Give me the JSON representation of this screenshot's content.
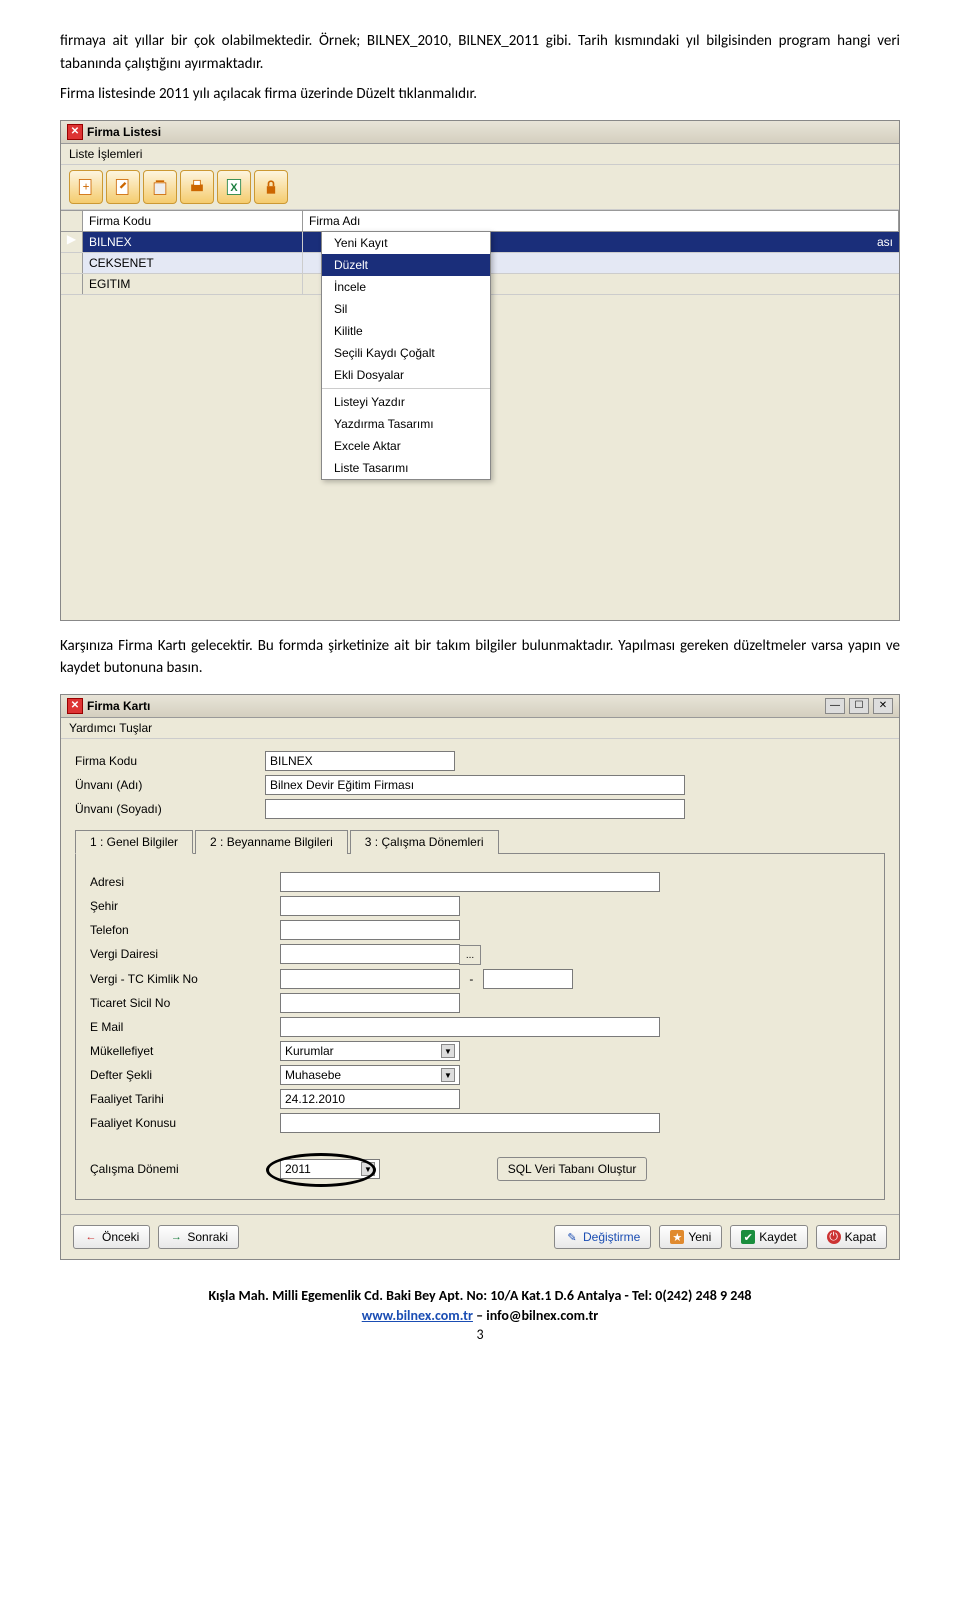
{
  "para1": "firmaya ait yıllar bir çok olabilmektedir. Örnek; BILNEX_2010, BILNEX_2011 gibi. Tarih kısmındaki yıl bilgisinden program hangi veri tabanında çalıştığını ayırmaktadır.",
  "para2": "Firma listesinde 2011 yılı açılacak firma üzerinde Düzelt tıklanmalıdır.",
  "firmaListesi": {
    "title": "Firma Listesi",
    "menu": "Liste İşlemleri",
    "col1": "Firma Kodu",
    "col2": "Firma Adı",
    "rows": [
      {
        "kod": "BILNEX",
        "adi": "ası"
      },
      {
        "kod": "CEKSENET",
        "adi": ""
      },
      {
        "kod": "EGITIM",
        "adi": ""
      }
    ],
    "ctx": {
      "yeniKayit": "Yeni Kayıt",
      "duzelt": "Düzelt",
      "incele": "İncele",
      "sil": "Sil",
      "kilitle": "Kilitle",
      "cogalt": "Seçili Kaydı Çoğalt",
      "ekli": "Ekli Dosyalar",
      "yazdir": "Listeyi Yazdır",
      "tasarim": "Yazdırma Tasarımı",
      "excel": "Excele Aktar",
      "listeTasarim": "Liste Tasarımı"
    }
  },
  "para3": "Karşınıza Firma Kartı gelecektir. Bu formda şirketinize ait bir takım bilgiler bulunmaktadır. Yapılması gereken düzeltmeler varsa yapın ve kaydet butonuna basın.",
  "firmaKarti": {
    "title": "Firma Kartı",
    "menu": "Yardımcı Tuşlar",
    "fields": {
      "firmaKoduLbl": "Firma Kodu",
      "firmaKoduVal": "BILNEX",
      "unvanAdiLbl": "Ünvanı (Adı)",
      "unvanAdiVal": "Bilnex Devir Eğitim Firması",
      "unvanSoyLbl": "Ünvanı (Soyadı)",
      "unvanSoyVal": ""
    },
    "tabs": {
      "t1": "1 : Genel Bilgiler",
      "t2": "2 : Beyanname Bilgileri",
      "t3": "3 : Çalışma Dönemleri"
    },
    "tab1": {
      "adresiLbl": "Adresi",
      "adresiVal": "",
      "sehirLbl": "Şehir",
      "sehirVal": "",
      "telLbl": "Telefon",
      "telVal": "",
      "vdLbl": "Vergi Dairesi",
      "vdVal": "",
      "vknLbl": "Vergi - TC Kimlik No",
      "vknVal1": "",
      "vknSep": "-",
      "vknVal2": "",
      "sicilLbl": "Ticaret Sicil No",
      "sicilVal": "",
      "emailLbl": "E Mail",
      "emailVal": "",
      "mukLbl": "Mükellefiyet",
      "mukVal": "Kurumlar",
      "defLbl": "Defter Şekli",
      "defVal": "Muhasebe",
      "faalTLbl": "Faaliyet Tarihi",
      "faalTVal": "24.12.2010",
      "faalKLbl": "Faaliyet Konusu",
      "faalKVal": "",
      "donemLbl": "Çalışma Dönemi",
      "donemVal": "2011",
      "sqlBtn": "SQL Veri Tabanı Oluştur"
    },
    "buttons": {
      "onceki": "Önceki",
      "sonraki": "Sonraki",
      "degistirme": "Değiştirme",
      "yeni": "Yeni",
      "kaydet": "Kaydet",
      "kapat": "Kapat"
    }
  },
  "footer": {
    "line1a": "Kışla Mah. Milli Egemenlik Cd. Baki Bey Apt. No: 10/A Kat.1 D.6 Antalya - Tel: 0(242) 248 9 248",
    "link": "www.bilnex.com.tr",
    "emailSep": " – ",
    "email": "info@bilnex.com.tr",
    "page": "3"
  }
}
